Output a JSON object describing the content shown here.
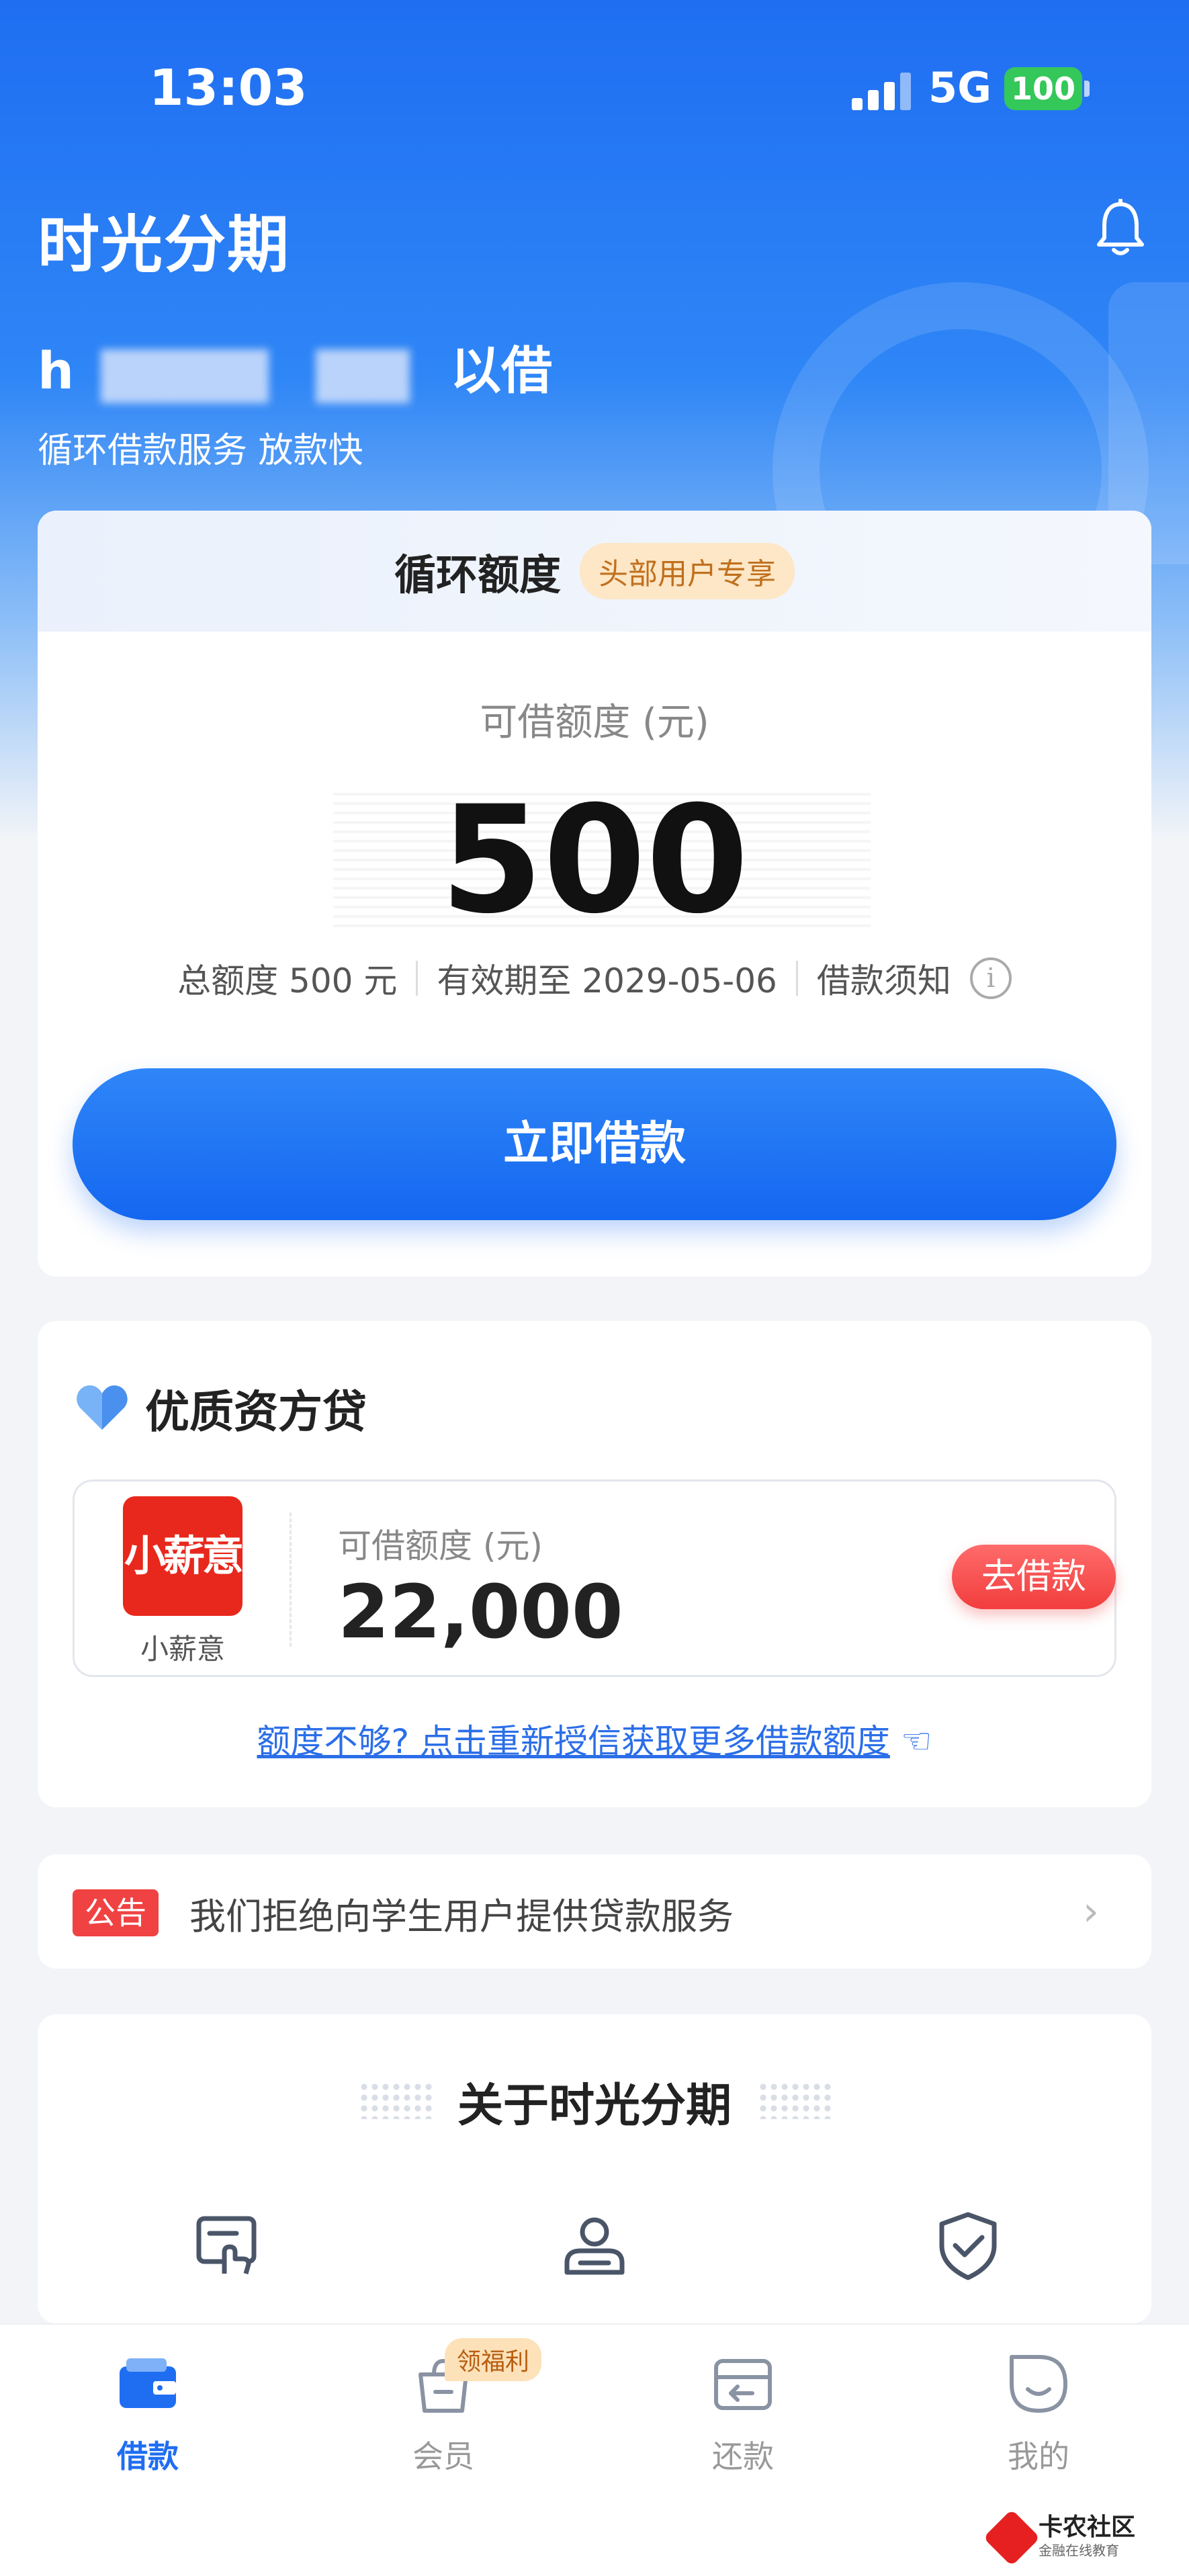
{
  "status_bar": {
    "time": "13:03",
    "network": "5G",
    "battery": "100"
  },
  "header": {
    "app_title": "时光分期"
  },
  "hero": {
    "slogan": "以借",
    "slogan_prefix": "h",
    "sub_slogan": "循环借款服务 放款快"
  },
  "credit_card": {
    "title": "循环额度",
    "badge": "头部用户专享",
    "available_label": "可借额度 (元)",
    "available_amount": "500",
    "total_limit": "总额度 500 元",
    "valid_until": "有效期至 2029-05-06",
    "notice_link": "借款须知",
    "info_icon": "i",
    "borrow_button": "立即借款"
  },
  "partner_card": {
    "title": "优质资方贷",
    "lender": {
      "logo_text": "小薪意",
      "name": "小薪意",
      "available_label": "可借额度 (元)",
      "available_amount": "22,000",
      "go_button": "去借款"
    },
    "reauth_link": "额度不够? 点击重新授信获取更多借款额度"
  },
  "notice": {
    "tag": "公告",
    "text": "我们拒绝向学生用户提供贷款服务",
    "arrow": "›"
  },
  "about": {
    "title": "关于时光分期"
  },
  "tabbar": {
    "tabs": [
      {
        "label": "借款",
        "icon": "wallet-icon",
        "active": true
      },
      {
        "label": "会员",
        "icon": "gift-bag-icon",
        "active": false
      },
      {
        "label": "还款",
        "icon": "card-icon",
        "active": false
      },
      {
        "label": "我的",
        "icon": "smile-icon",
        "active": false
      }
    ],
    "welfare_badge": "领福利"
  },
  "watermark": {
    "title": "卡农社区",
    "subtitle": "金融在线教育"
  },
  "colors": {
    "primary": "#1f6ef2",
    "danger": "#f04242",
    "lender_logo": "#e8281c"
  }
}
